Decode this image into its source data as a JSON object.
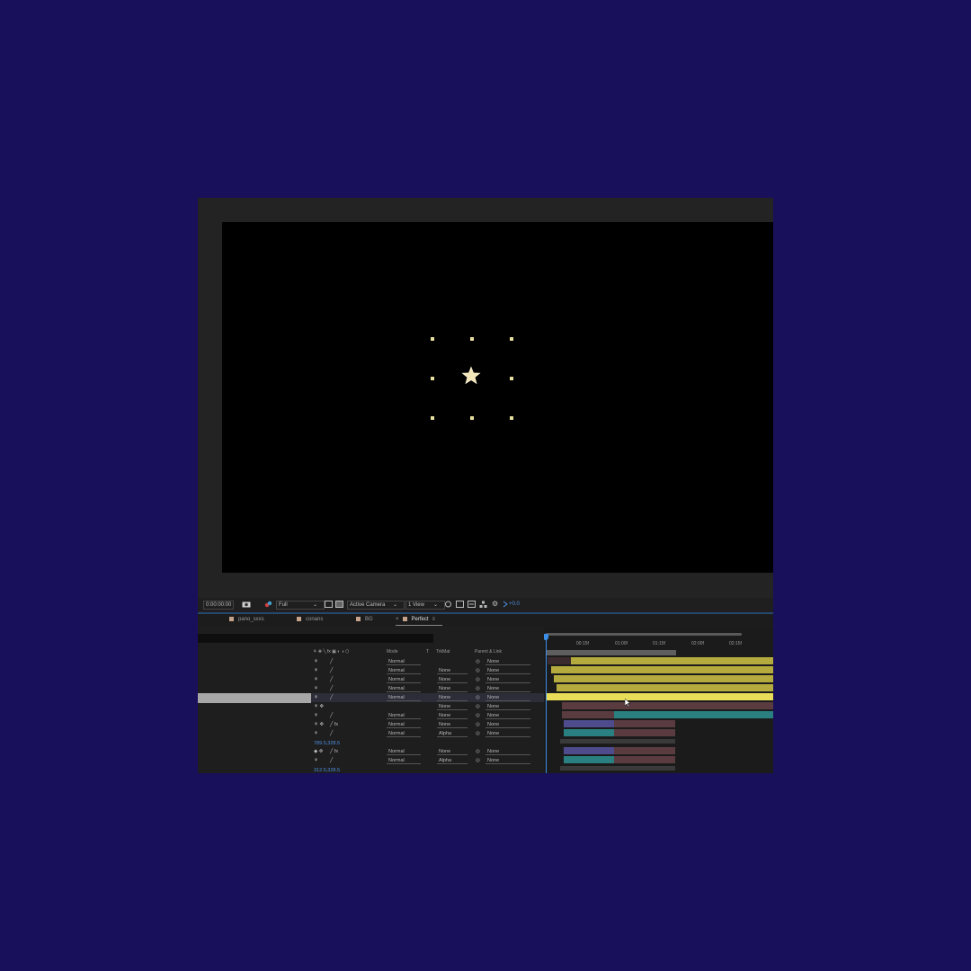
{
  "viewer_toolbar": {
    "timecode": "0:00:00:00",
    "resolution": "Full",
    "camera": "Active Camera",
    "view_layout": "1 View",
    "exposure": "+0.0"
  },
  "tabs": [
    {
      "label": "pano_sxxs"
    },
    {
      "label": "conans"
    },
    {
      "label": "BG"
    },
    {
      "label": "Perfect",
      "active": true
    }
  ],
  "columns": {
    "mode": "Mode",
    "t": "T",
    "trkmat": "TrkMat",
    "parent": "Parent & Link"
  },
  "layers": [
    {
      "mode": "Normal",
      "trkmat": "",
      "parent": "None"
    },
    {
      "mode": "Normal",
      "trkmat": "None",
      "parent": "None"
    },
    {
      "mode": "Normal",
      "trkmat": "None",
      "parent": "None"
    },
    {
      "mode": "Normal",
      "trkmat": "None",
      "parent": "None"
    },
    {
      "mode": "Normal",
      "trkmat": "None",
      "parent": "None"
    },
    {
      "mode": "",
      "trkmat": "None",
      "parent": "None"
    },
    {
      "mode": "Normal",
      "trkmat": "None",
      "parent": "None"
    },
    {
      "mode": "Normal",
      "trkmat": "None",
      "parent": "None"
    },
    {
      "mode": "Normal",
      "trkmat": "Alpha",
      "parent": "None"
    },
    {
      "mode": "Normal",
      "trkmat": "None",
      "parent": "None"
    },
    {
      "mode": "Normal",
      "trkmat": "Alpha",
      "parent": "None"
    }
  ],
  "values": {
    "pos1": "789.5,328.5",
    "pos2": "312.5,328.5"
  },
  "ruler": [
    "00:15f",
    "01:00f",
    "01:15f",
    "02:00f",
    "02:15f"
  ],
  "colors": {
    "background": "#18105a",
    "panel": "#232323",
    "accent": "#2a6db5",
    "layer_yellow": "#b5aa3d",
    "layer_teal": "#2a8080",
    "layer_purple": "#4e4c8c",
    "layer_rose": "#5a3c40"
  }
}
